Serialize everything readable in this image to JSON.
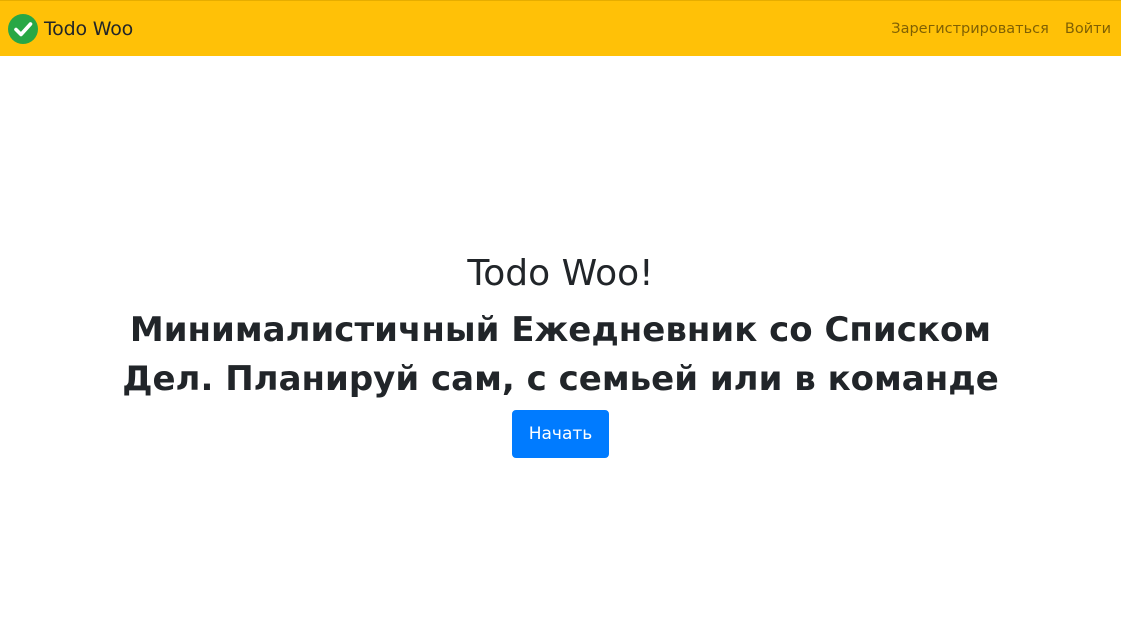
{
  "navbar": {
    "brand_name": "Todo Woo",
    "logo_icon": "check-circle-icon",
    "links": [
      {
        "label": "Зарегистрироваться"
      },
      {
        "label": "Войти"
      }
    ]
  },
  "hero": {
    "title": "Todo Woo!",
    "subtitle": "Минималистичный Ежедневник со Списком Дел. Планируй сам, с семьей или в команде",
    "button_label": "Начать"
  },
  "colors": {
    "navbar_bg": "#ffc107",
    "logo_green": "#28a745",
    "button_blue": "#007bff",
    "text_dark": "#212529"
  }
}
